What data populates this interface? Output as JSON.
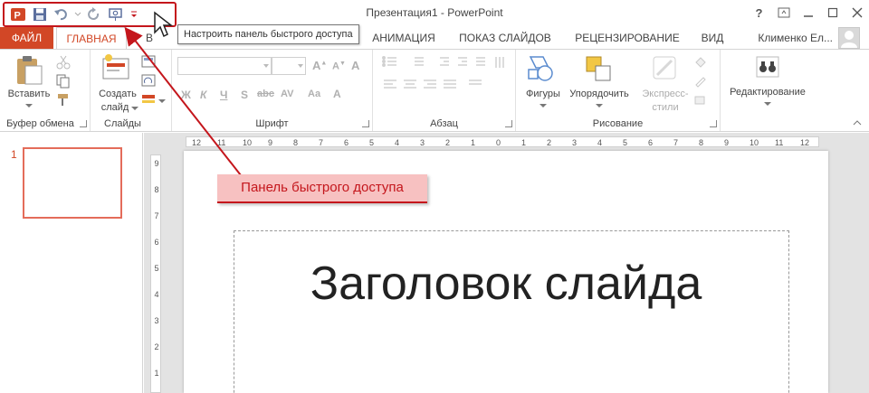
{
  "window": {
    "title": "Презентация1 - PowerPoint",
    "help": "?"
  },
  "qat": {
    "tooltip": "Настроить панель быстрого доступа"
  },
  "tabs": {
    "file": "ФАЙЛ",
    "home": "ГЛАВНАЯ",
    "insert_partial": "В",
    "animation": "АНИМАЦИЯ",
    "slideshow": "ПОКАЗ СЛАЙДОВ",
    "review": "РЕЦЕНЗИРОВАНИЕ",
    "view": "ВИД"
  },
  "user": {
    "name": "Клименко Ел..."
  },
  "ribbon": {
    "clipboard": {
      "paste": "Вставить",
      "label": "Буфер обмена"
    },
    "slides": {
      "new_slide_line1": "Создать",
      "new_slide_line2": "слайд",
      "label": "Слайды"
    },
    "font": {
      "label": "Шрифт",
      "bold": "Ж",
      "italic": "К",
      "underline": "Ч",
      "strike": "S",
      "shadow": "abc",
      "spacing": "AV",
      "case": "Aa",
      "color": "A"
    },
    "paragraph": {
      "label": "Абзац"
    },
    "drawing": {
      "shapes": "Фигуры",
      "arrange": "Упорядочить",
      "styles_line1": "Экспресс-",
      "styles_line2": "стили",
      "label": "Рисование"
    },
    "editing": {
      "label": "Редактирование"
    }
  },
  "thumbs": {
    "slide_number": "1"
  },
  "ruler": {
    "h": [
      "12",
      "11",
      "10",
      "9",
      "8",
      "7",
      "6",
      "5",
      "4",
      "3",
      "2",
      "1",
      "0",
      "1",
      "2",
      "3",
      "4",
      "5",
      "6",
      "7",
      "8",
      "9",
      "10",
      "11",
      "12"
    ],
    "v": [
      "9",
      "8",
      "7",
      "6",
      "5",
      "4",
      "3",
      "2",
      "1"
    ]
  },
  "slide": {
    "title": "Заголовок слайда"
  },
  "annotation": {
    "text": "Панель быстрого доступа"
  },
  "colors": {
    "accent": "#d24726",
    "annotation": "#c4161c"
  }
}
